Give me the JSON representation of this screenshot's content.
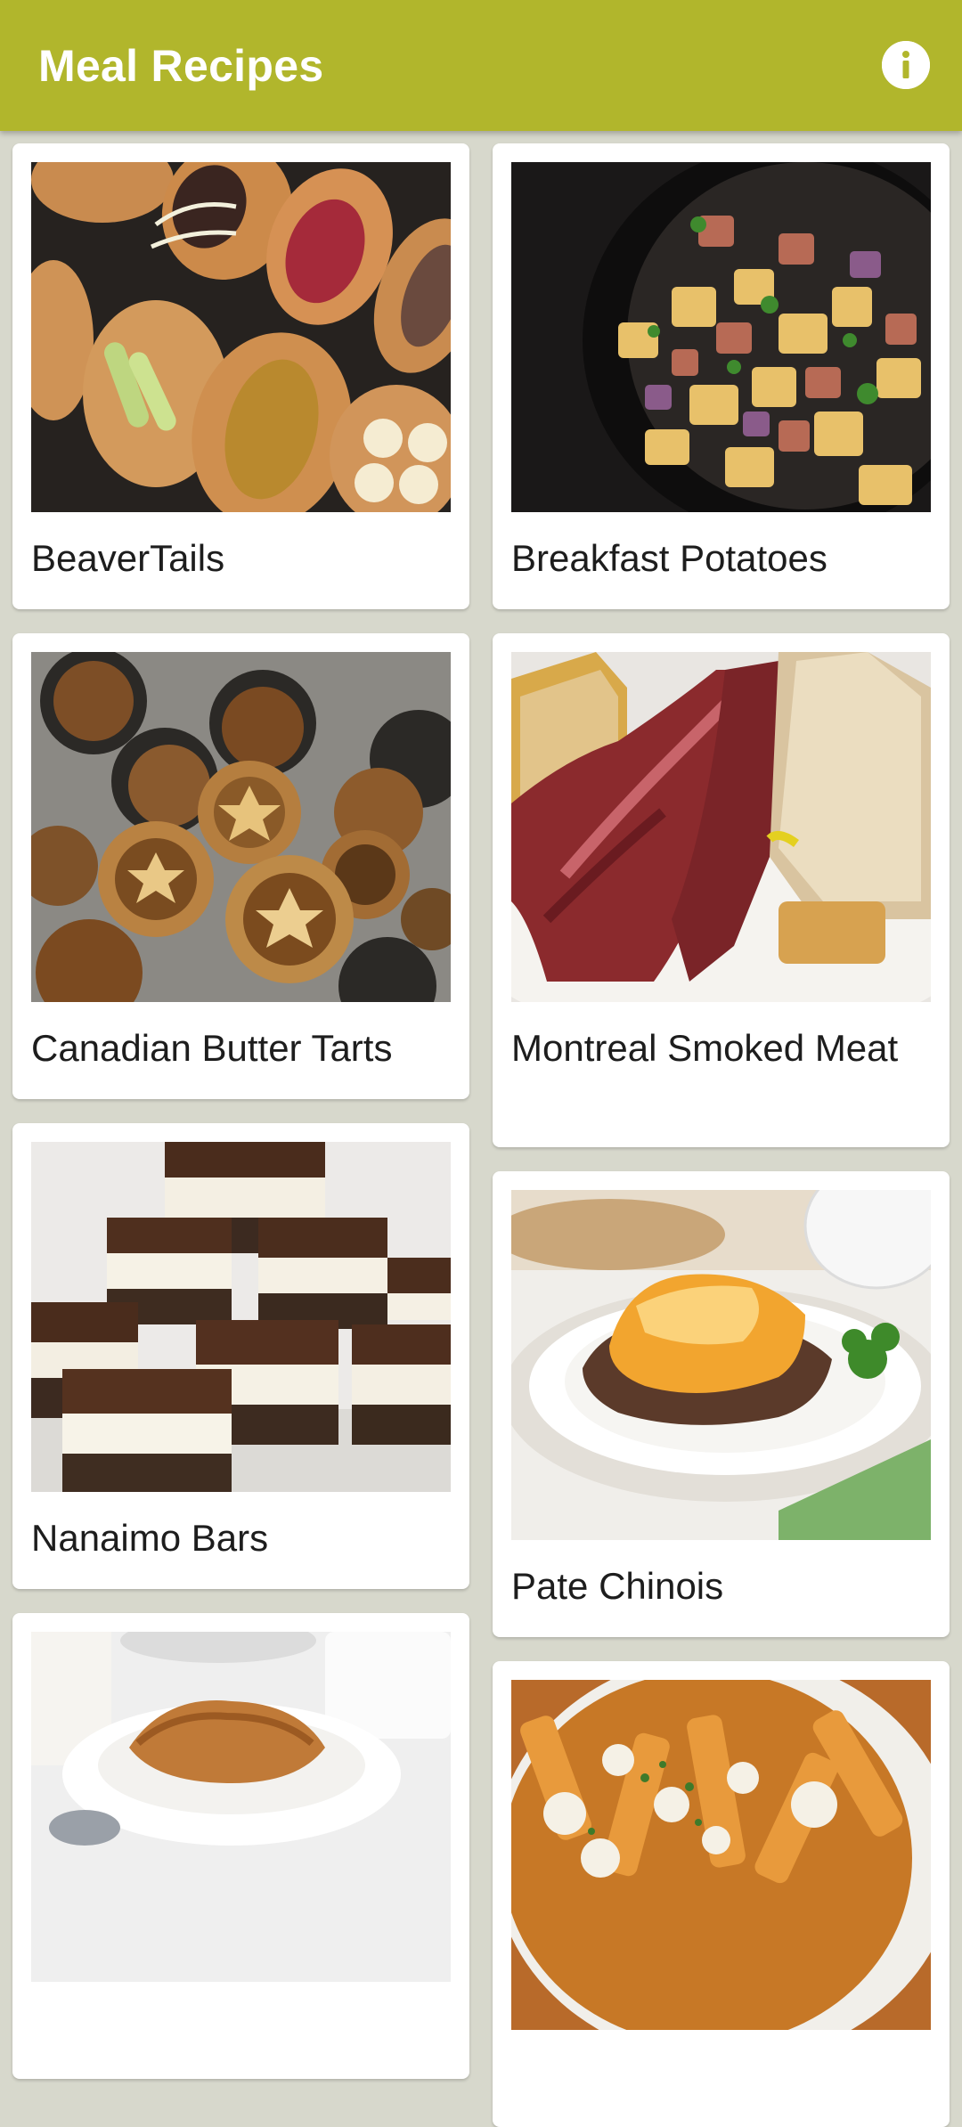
{
  "app": {
    "title": "Meal Recipes",
    "accent_color": "#b1b62c",
    "background_color": "#d7d8cc",
    "info_icon": "info-icon"
  },
  "recipes": [
    {
      "name": "BeaverTails"
    },
    {
      "name": "Breakfast Potatoes"
    },
    {
      "name": "Canadian Butter Tarts"
    },
    {
      "name": "Montreal Smoked Meat"
    },
    {
      "name": "Nanaimo Bars"
    },
    {
      "name": "Pate Chinois"
    },
    {
      "name": ""
    },
    {
      "name": ""
    }
  ]
}
